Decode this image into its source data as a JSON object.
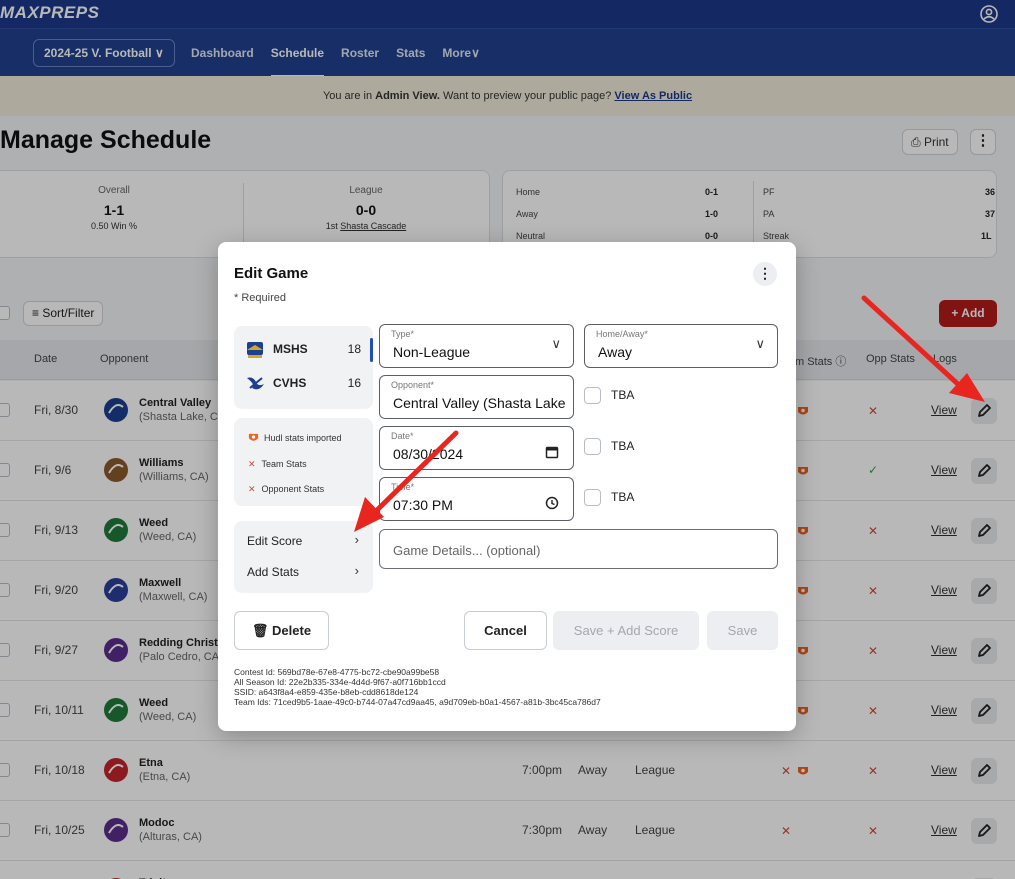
{
  "brand": {
    "logo_text": "MAXPREPS"
  },
  "nav": {
    "season_label": "2024-25 V. Football",
    "tabs": [
      {
        "label": "Dashboard"
      },
      {
        "label": "Schedule"
      },
      {
        "label": "Roster"
      },
      {
        "label": "Stats"
      },
      {
        "label": "More"
      }
    ]
  },
  "admin_banner": {
    "prefix": "You are in",
    "mode": "Admin View.",
    "suffix": "Want to preview your public page?",
    "link": "View As Public"
  },
  "page": {
    "title": "Manage Schedule",
    "print_label": "Print",
    "more_label": "⋮"
  },
  "records": {
    "overall": {
      "label": "Overall",
      "value": "1-1",
      "sub": "0.50 Win %"
    },
    "league": {
      "label": "League",
      "value": "0-0",
      "sub_prefix": "1st",
      "sub_link": "Shasta Cascade"
    },
    "splits": [
      {
        "label": "Home",
        "value": "0-1"
      },
      {
        "label": "Away",
        "value": "1-0"
      },
      {
        "label": "Neutral",
        "value": "0-0"
      }
    ],
    "points": [
      {
        "label": "PF",
        "value": "36"
      },
      {
        "label": "PA",
        "value": "37"
      },
      {
        "label": "Streak",
        "value": "1L"
      }
    ]
  },
  "toolbar": {
    "sort_label": "Sort/Filter",
    "add_label": "+ Add"
  },
  "table": {
    "headers": {
      "date": "Date",
      "opponent": "Opponent",
      "team_stats": "m Stats ⓘ",
      "opp_stats": "Opp Stats",
      "logs": "Logs"
    },
    "view_label": "View",
    "rows": [
      {
        "date": "Fri, 8/30",
        "name": "Central Valley",
        "location": "(Shasta Lake, C",
        "time": "",
        "ha": "",
        "type": "",
        "team_stat": "hudl",
        "opp_stat": "cross",
        "logo_color": "#1d3f8f"
      },
      {
        "date": "Fri, 9/6",
        "name": "Williams",
        "location": "(Williams, CA)",
        "time": "",
        "ha": "",
        "type": "",
        "team_stat": "hudl",
        "opp_stat": "check",
        "logo_color": "#8a5a2b"
      },
      {
        "date": "Fri, 9/13",
        "name": "Weed",
        "location": "(Weed, CA)",
        "time": "",
        "ha": "",
        "type": "",
        "team_stat": "hudl",
        "opp_stat": "cross",
        "logo_color": "#1f7a3a"
      },
      {
        "date": "Fri, 9/20",
        "name": "Maxwell",
        "location": "(Maxwell, CA)",
        "time": "",
        "ha": "",
        "type": "",
        "team_stat": "hudl",
        "opp_stat": "cross",
        "logo_color": "#2a3f9a"
      },
      {
        "date": "Fri, 9/27",
        "name": "Redding Christ",
        "location": "(Palo Cedro, CA",
        "time": "",
        "ha": "",
        "type": "",
        "team_stat": "hudl",
        "opp_stat": "cross",
        "logo_color": "#5b2e8c"
      },
      {
        "date": "Fri, 10/11",
        "name": "Weed",
        "location": "(Weed, CA)",
        "time": "",
        "ha": "",
        "type": "",
        "team_stat": "hudl",
        "opp_stat": "cross",
        "logo_color": "#1f7a3a"
      },
      {
        "date": "Fri, 10/18",
        "name": "Etna",
        "location": "(Etna, CA)",
        "time": "7:00pm",
        "ha": "Away",
        "type": "League",
        "team_stat": "cross-hudl",
        "opp_stat": "cross",
        "logo_color": "#c4242a"
      },
      {
        "date": "Fri, 10/25",
        "name": "Modoc",
        "location": "(Alturas, CA)",
        "time": "7:30pm",
        "ha": "Away",
        "type": "League",
        "team_stat": "cross",
        "opp_stat": "cross",
        "logo_color": "#5b2e8c"
      },
      {
        "date": "",
        "name": "Trinity",
        "location": "",
        "time": "",
        "ha": "",
        "type": "",
        "team_stat": "",
        "opp_stat": "",
        "logo_color": "#c4242a"
      }
    ]
  },
  "modal": {
    "title": "Edit Game",
    "required_note": "* Required",
    "teams": [
      {
        "abbr": "MSHS",
        "score": "18"
      },
      {
        "abbr": "CVHS",
        "score": "16"
      }
    ],
    "info": {
      "hudl_label": "Hudl stats imported",
      "team_stats": "Team Stats",
      "opp_stats": "Opponent Stats"
    },
    "actions": [
      {
        "label": "Edit Score"
      },
      {
        "label": "Add Stats"
      }
    ],
    "fields": {
      "type": {
        "label": "Type*",
        "value": "Non-League"
      },
      "home_away": {
        "label": "Home/Away*",
        "value": "Away"
      },
      "opponent": {
        "label": "Opponent*",
        "value": "Central Valley (Shasta Lake,"
      },
      "date": {
        "label": "Date*",
        "value": "08/30/2024"
      },
      "time": {
        "label": "Time*",
        "value": "07:30 PM"
      },
      "details": {
        "placeholder": "Game Details... (optional)"
      }
    },
    "tba_label": "TBA",
    "buttons": {
      "delete": "Delete",
      "cancel": "Cancel",
      "save_add_score": "Save + Add Score",
      "save": "Save"
    },
    "ids": [
      "Contest Id: 569bd78e-67e8-4775-bc72-cbe90a99be58",
      "All Season Id: 22e2b335-334e-4d4d-9f67-a0f716bb1ccd",
      "SSID: a643f8a4-e859-435e-b8eb-cdd8618de124",
      "Team Ids: 71ced9b5-1aae-49c0-b744-07a47cd9aa45, a9d709eb-b0a1-4567-a81b-3bc45ca786d7"
    ]
  },
  "colors": {
    "brand_blue": "#1d3a8a",
    "nav_blue": "#20418f",
    "add_red": "#b31b1b",
    "annotation_red": "#e8261f",
    "hudl_orange": "#f0621f"
  }
}
